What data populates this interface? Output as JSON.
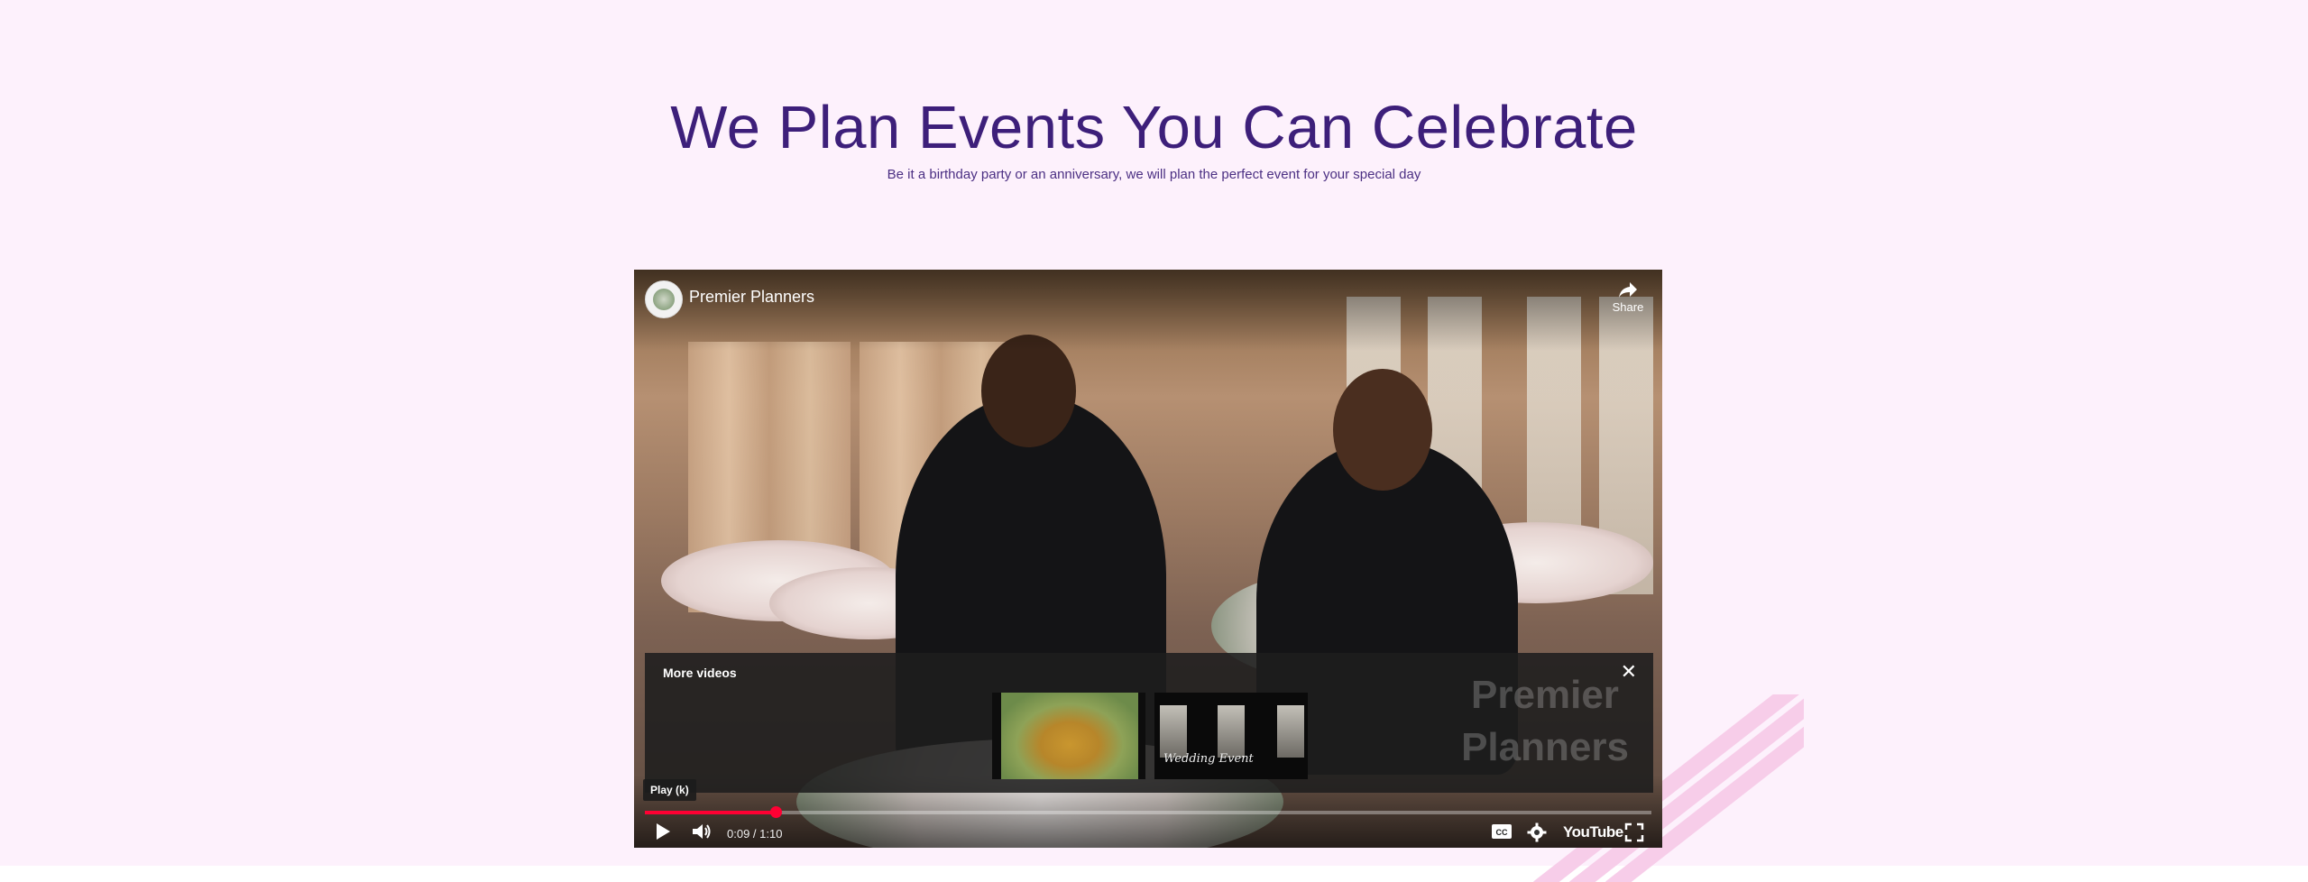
{
  "header": {
    "title": "We Plan Events You Can Celebrate",
    "subtitle": "Be it a birthday party or an anniversary, we will plan the perfect event for your special day"
  },
  "video": {
    "channel_name": "Premier Planners",
    "share_label": "Share",
    "more_videos_label": "More videos",
    "watermark_line1": "Premier",
    "watermark_line2": "Planners",
    "thumbnail_2_script": "Wedding Event",
    "tooltip": "Play (k)",
    "time_display": "0:09 / 1:10",
    "progress_fraction": 0.13,
    "youtube_label": "YouTube"
  },
  "colors": {
    "background": "#fdf1fc",
    "title": "#3d1f7a",
    "progress": "#ff0033"
  },
  "icons": [
    "share-icon",
    "close-icon",
    "play-icon",
    "volume-icon",
    "captions-icon",
    "gear-icon",
    "fullscreen-icon"
  ]
}
